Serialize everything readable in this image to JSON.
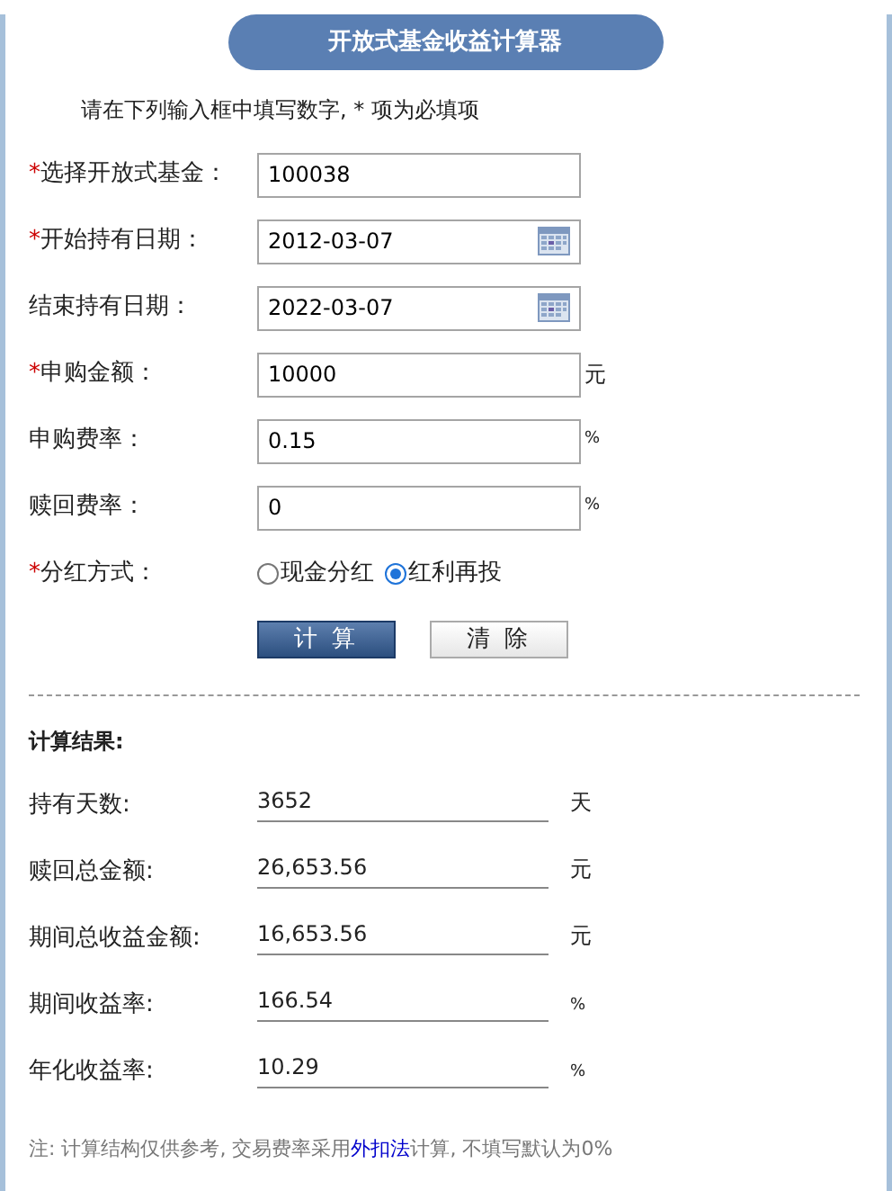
{
  "title": "开放式基金收益计算器",
  "instruction": "请在下列输入框中填写数字, * 项为必填项",
  "fields": [
    {
      "kind": "text",
      "marker": "*",
      "label": "选择开放式基金：",
      "value": "100038"
    },
    {
      "kind": "date",
      "marker": "*",
      "label": "开始持有日期：",
      "value": "2012-03-07"
    },
    {
      "kind": "date",
      "label": "结束持有日期：",
      "value": "2022-03-07"
    },
    {
      "kind": "text",
      "marker": "*",
      "label": "申购金额：",
      "value": "10000",
      "unit": "元"
    },
    {
      "kind": "text",
      "label": "申购费率：",
      "value": "0.15",
      "unit": "%"
    },
    {
      "kind": "text",
      "label": "赎回费率：",
      "value": "0",
      "unit": "%"
    },
    {
      "kind": "radio",
      "marker": "*",
      "label": "分红方式：",
      "options": [
        {
          "label": "现金分红",
          "selected": false
        },
        {
          "label": "红利再投",
          "selected": true
        }
      ]
    }
  ],
  "buttons": [
    {
      "kind": "primary",
      "label": "计 算"
    },
    {
      "kind": "secondary",
      "label": "清 除"
    }
  ],
  "results": {
    "heading": "计算结果:",
    "rows": [
      {
        "label": "持有天数:",
        "value": "3652",
        "unit": "天"
      },
      {
        "label": "赎回总金额:",
        "value": "26,653.56",
        "unit": "元"
      },
      {
        "label": "期间总收益金额:",
        "value": "16,653.56",
        "unit": "元"
      },
      {
        "label": "期间收益率:",
        "value": "166.54",
        "unit": "%"
      },
      {
        "label": "年化收益率:",
        "value": "10.29",
        "unit": "%"
      }
    ]
  },
  "note": {
    "before": "注: 计算结构仅供参考, 交易费率采用",
    "link": "外扣法",
    "after": "计算, 不填写默认为0%"
  }
}
